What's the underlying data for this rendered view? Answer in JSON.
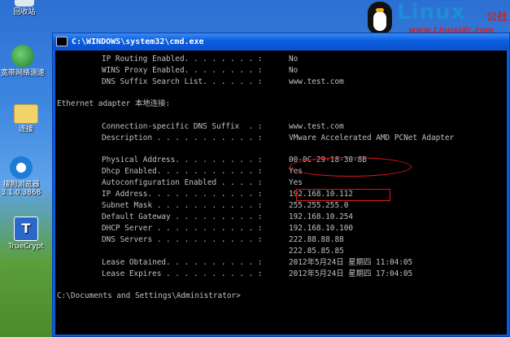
{
  "desktop": {
    "icons": [
      {
        "label": "回收站"
      },
      {
        "label": "宽带网络测速"
      },
      {
        "label": "连接"
      },
      {
        "label": "搜狗浏览器 3.1.0.3868"
      },
      {
        "label": "TrueCrypt"
      }
    ]
  },
  "logo": {
    "brand": "Linux",
    "brand_cn": "公社",
    "url": "www.Linuxidc.com"
  },
  "window": {
    "title": "C:\\WINDOWS\\system32\\cmd.exe",
    "lines": [
      {
        "label": "IP Routing Enabled. . . . . . . . :",
        "value": "No"
      },
      {
        "label": "WINS Proxy Enabled. . . . . . . . :",
        "value": "No"
      },
      {
        "label": "DNS Suffix Search List. . . . . . :",
        "value": "www.test.com"
      }
    ],
    "adapter_header": "Ethernet adapter 本地连接:",
    "adapter_lines": [
      {
        "label": "Connection-specific DNS Suffix  . :",
        "value": "www.test.com"
      },
      {
        "label": "Description . . . . . . . . . . . :",
        "value": "VMware Accelerated AMD PCNet Adapter"
      },
      {
        "label": "Physical Address. . . . . . . . . :",
        "value": "00-0C-29-18-30-8B"
      },
      {
        "label": "Dhcp Enabled. . . . . . . . . . . :",
        "value": "Yes"
      },
      {
        "label": "Autoconfiguration Enabled . . . . :",
        "value": "Yes"
      },
      {
        "label": "IP Address. . . . . . . . . . . . :",
        "value": "192.168.10.112"
      },
      {
        "label": "Subnet Mask . . . . . . . . . . . :",
        "value": "255.255.255.0"
      },
      {
        "label": "Default Gateway . . . . . . . . . :",
        "value": "192.168.10.254"
      },
      {
        "label": "DHCP Server . . . . . . . . . . . :",
        "value": "192.168.10.100"
      },
      {
        "label": "DNS Servers . . . . . . . . . . . :",
        "value": "222.88.88.88"
      },
      {
        "label": "",
        "value": "222.85.85.85"
      },
      {
        "label": "Lease Obtained. . . . . . . . . . :",
        "value": "2012年5月24日 星期四 11:04:05"
      },
      {
        "label": "Lease Expires . . . . . . . . . . :",
        "value": "2012年5月24日 星期四 17:04:05"
      }
    ],
    "prompt": "C:\\Documents and Settings\\Administrator>"
  }
}
